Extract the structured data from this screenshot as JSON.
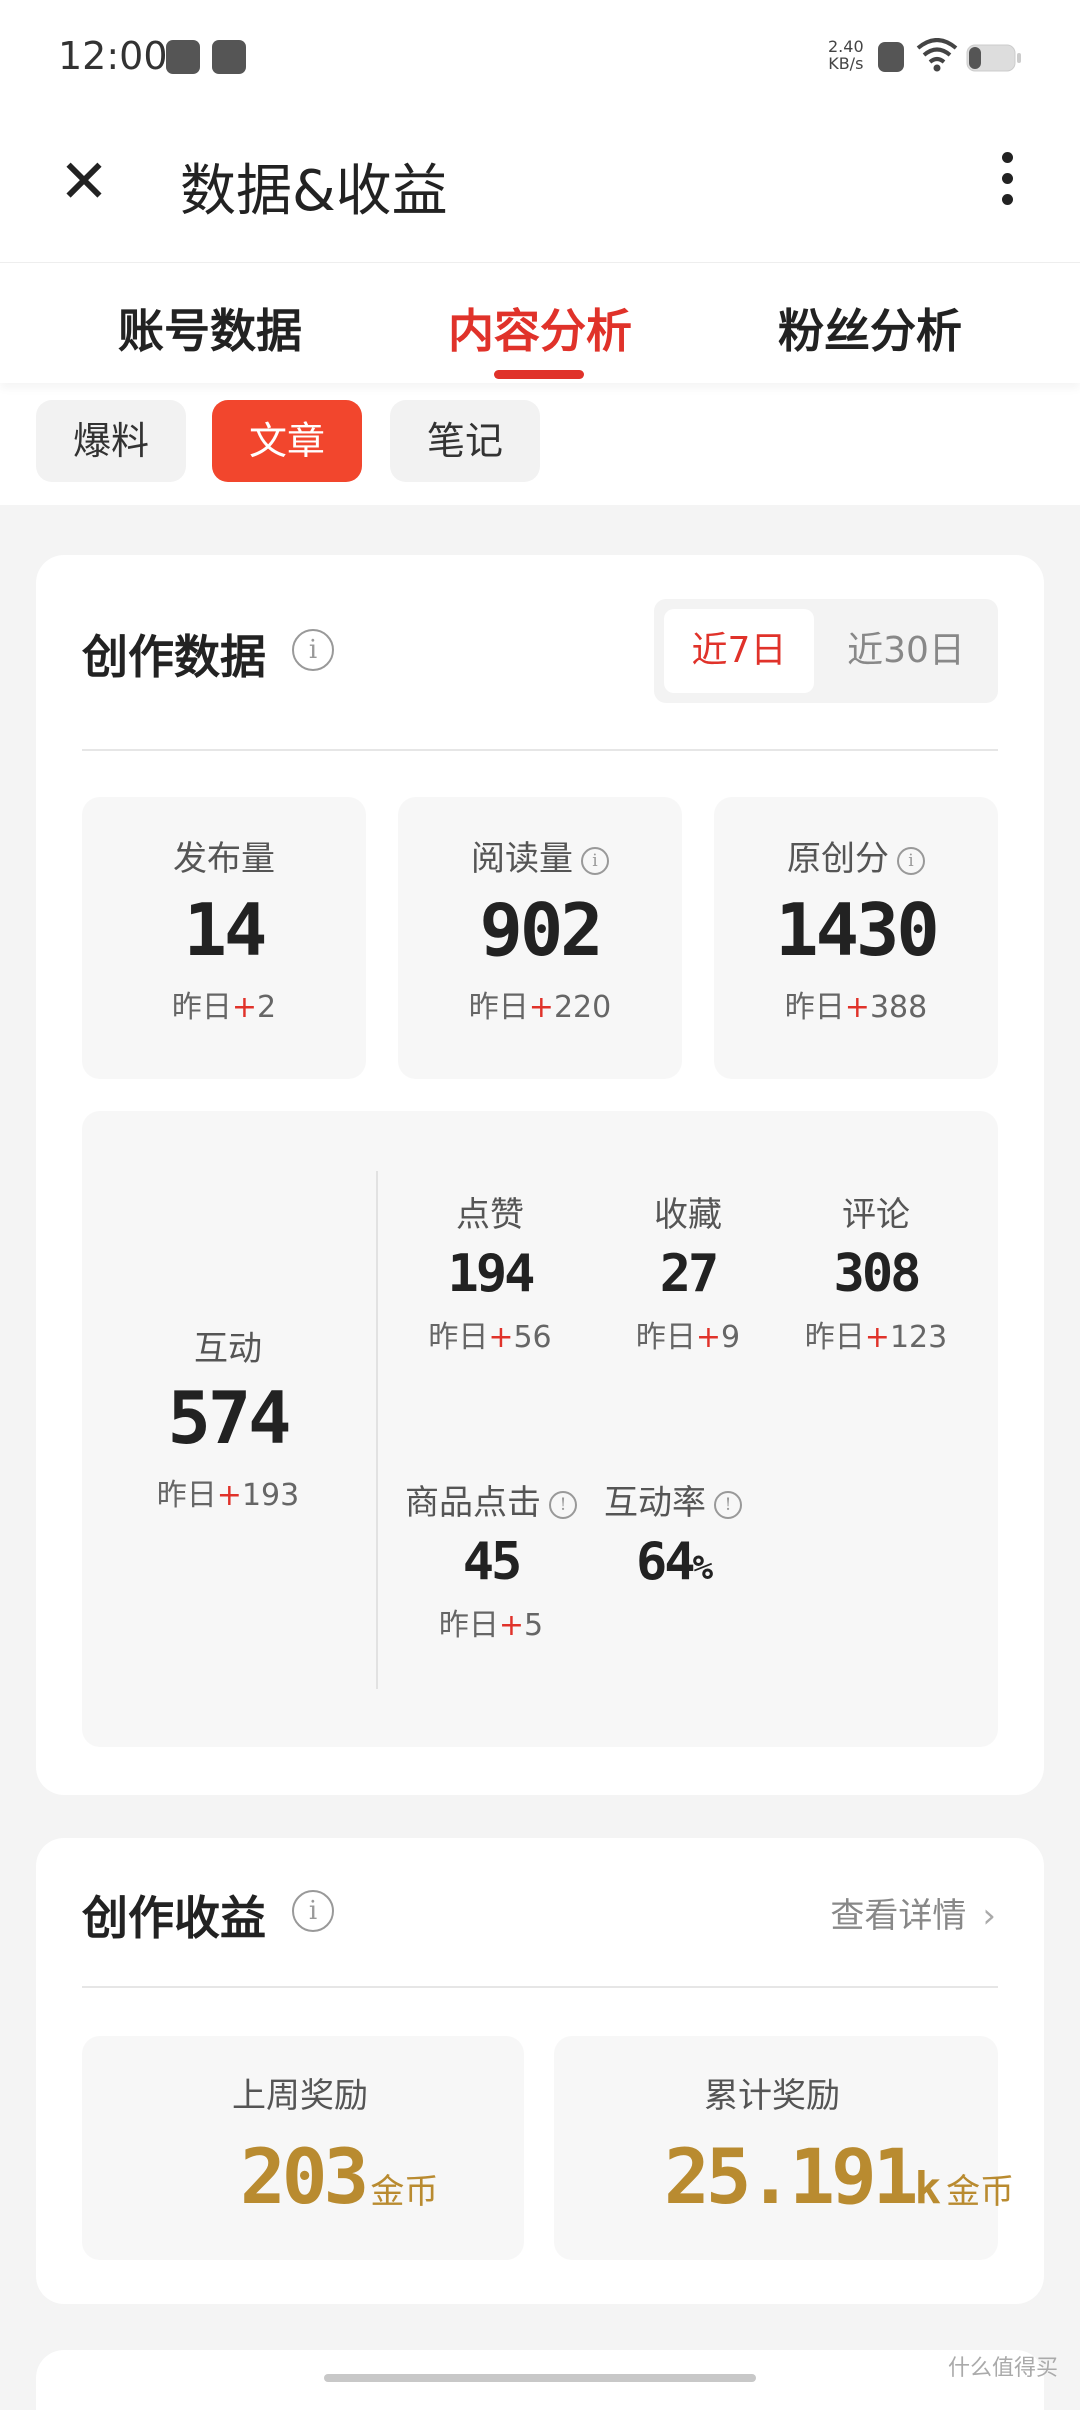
{
  "status_bar": {
    "time": "12:00",
    "speed_value": "2.40",
    "speed_unit": "KB/s"
  },
  "app_bar": {
    "title": "数据&收益",
    "close_icon": "✕"
  },
  "tabs": [
    {
      "label": "账号数据",
      "active": false
    },
    {
      "label": "内容分析",
      "active": true
    },
    {
      "label": "粉丝分析",
      "active": false
    }
  ],
  "chips": [
    {
      "label": "爆料",
      "active": false
    },
    {
      "label": "文章",
      "active": true
    },
    {
      "label": "笔记",
      "active": false
    }
  ],
  "creation": {
    "title": "创作数据",
    "ranges": [
      {
        "label": "近7日",
        "active": true
      },
      {
        "label": "近30日",
        "active": false
      }
    ],
    "stats": [
      {
        "label": "发布量",
        "value": "14",
        "delta_prefix": "昨日",
        "delta_sign": "+",
        "delta": "2"
      },
      {
        "label": "阅读量",
        "value": "902",
        "delta_prefix": "昨日",
        "delta_sign": "+",
        "delta": "220"
      },
      {
        "label": "原创分",
        "value": "1430",
        "delta_prefix": "昨日",
        "delta_sign": "+",
        "delta": "388"
      }
    ],
    "interaction": {
      "label": "互动",
      "value": "574",
      "delta_prefix": "昨日",
      "delta_sign": "+",
      "delta": "193",
      "items": [
        {
          "label": "点赞",
          "value": "194",
          "delta_prefix": "昨日",
          "delta_sign": "+",
          "delta": "56"
        },
        {
          "label": "收藏",
          "value": "27",
          "delta_prefix": "昨日",
          "delta_sign": "+",
          "delta": "9"
        },
        {
          "label": "评论",
          "value": "308",
          "delta_prefix": "昨日",
          "delta_sign": "+",
          "delta": "123"
        },
        {
          "label": "商品点击",
          "value": "45",
          "delta_prefix": "昨日",
          "delta_sign": "+",
          "delta": "5"
        },
        {
          "label": "互动率",
          "value": "64",
          "unit": "%"
        }
      ]
    }
  },
  "earnings": {
    "title": "创作收益",
    "detail_link": "查看详情",
    "rewards": [
      {
        "label": "上周奖励",
        "value": "203",
        "suffix": "",
        "unit": "金币"
      },
      {
        "label": "累计奖励",
        "value": "25.191",
        "suffix": "k",
        "unit": "金币"
      }
    ]
  },
  "watermark": "什么值得买",
  "colors": {
    "accent": "#e0322a",
    "chip_active": "#f2462d",
    "gold": "#b98b30"
  }
}
